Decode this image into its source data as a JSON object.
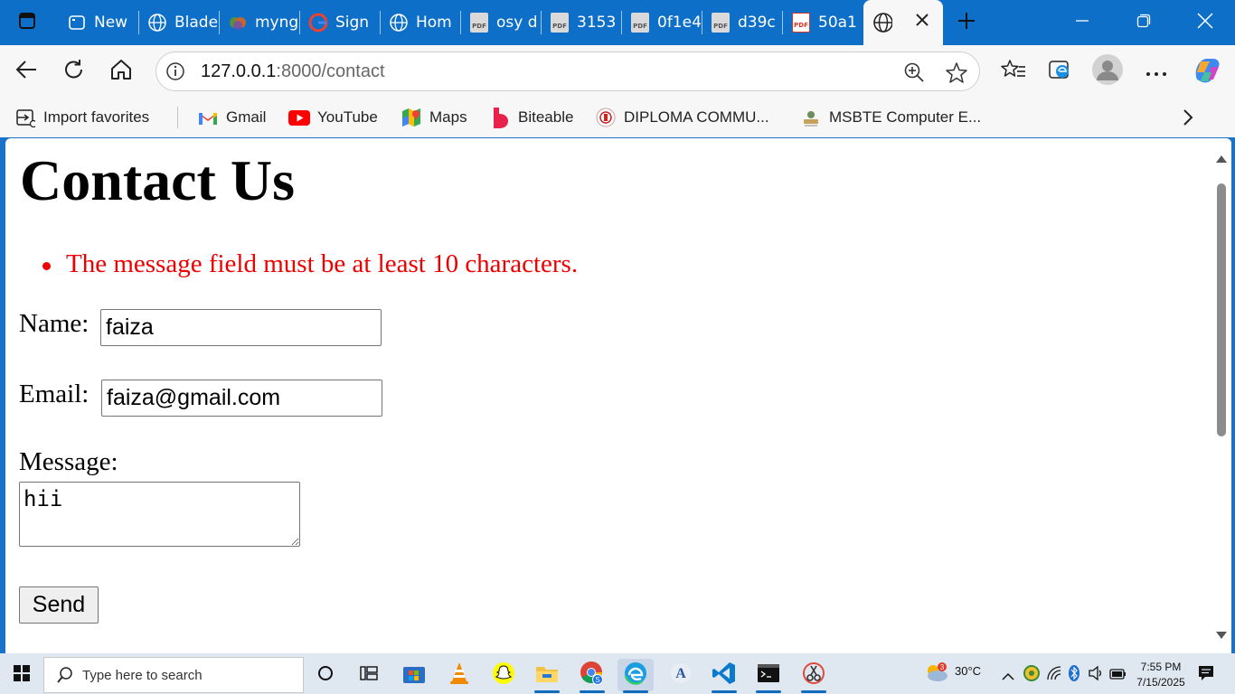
{
  "browser": {
    "tabs": [
      {
        "label": "New",
        "icon": "window-icon"
      },
      {
        "label": "Blade",
        "icon": "globe-icon"
      },
      {
        "label": "myng",
        "icon": "mongo-icon"
      },
      {
        "label": "Sign",
        "icon": "google-icon"
      },
      {
        "label": "Hom",
        "icon": "globe-icon"
      },
      {
        "label": "osy d",
        "icon": "pdf-icon"
      },
      {
        "label": "3153",
        "icon": "pdf-icon"
      },
      {
        "label": "0f1e4",
        "icon": "pdf-icon"
      },
      {
        "label": "d39c",
        "icon": "pdf-icon"
      },
      {
        "label": "50a1",
        "icon": "pdf-red-icon"
      }
    ],
    "active_tab": {
      "label": "",
      "icon": "globe-icon"
    },
    "address": {
      "host": "127.0.0.1",
      "path": ":8000/contact"
    },
    "favorites": [
      {
        "label": "Import favorites",
        "icon": "import-icon"
      },
      {
        "label": "Gmail",
        "icon": "gmail-icon"
      },
      {
        "label": "YouTube",
        "icon": "youtube-icon"
      },
      {
        "label": "Maps",
        "icon": "maps-icon"
      },
      {
        "label": "Biteable",
        "icon": "biteable-icon"
      },
      {
        "label": "DIPLOMA COMMU...",
        "icon": "diploma-icon"
      },
      {
        "label": "MSBTE Computer E...",
        "icon": "msbte-icon"
      }
    ]
  },
  "page": {
    "title": "Contact Us",
    "errors": [
      "The message field must be at least 10 characters."
    ],
    "form": {
      "name_label": "Name:",
      "name_value": "faiza",
      "email_label": "Email:",
      "email_value": "faiza@gmail.com",
      "message_label": "Message:",
      "message_value": "hii",
      "send_label": "Send"
    }
  },
  "taskbar": {
    "search_placeholder": "Type here to search",
    "weather": "30°C",
    "weather_badge": "3",
    "time": "7:55 PM",
    "date": "7/15/2025",
    "store_badge": "S"
  },
  "colors": {
    "titlebar": "#0e6fc9",
    "error": "#e00000",
    "accent": "#0f6cbd"
  }
}
